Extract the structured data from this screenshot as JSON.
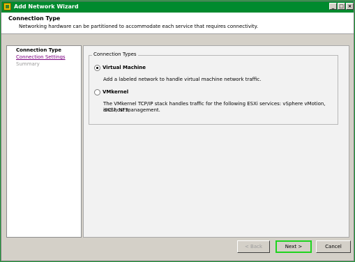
{
  "window": {
    "title": "Add Network Wizard",
    "buttons": {
      "minimize": "_",
      "maximize": "□",
      "close": "×"
    }
  },
  "header": {
    "title": "Connection Type",
    "description": "Networking hardware can be partitioned to accommodate each service that requires connectivity."
  },
  "nav": {
    "items": [
      {
        "label": "Connection Type",
        "state": "current"
      },
      {
        "label": "Connection Settings",
        "state": "link"
      },
      {
        "label": "Summary",
        "state": "disabled"
      }
    ]
  },
  "connection_types": {
    "legend": "Connection Types",
    "options": [
      {
        "label": "Virtual Machine",
        "description": "Add a labeled network to handle virtual machine network traffic.",
        "selected": true
      },
      {
        "label": "VMkernel",
        "description_line1": "The VMkernel TCP/IP stack handles traffic for the following ESXi services: vSphere vMotion, iSCSI, NFS,",
        "description_line2": "and host management.",
        "selected": false
      }
    ]
  },
  "footer": {
    "back_label": "< Back",
    "next_label": "Next >",
    "cancel_label": "Cancel"
  },
  "colors": {
    "titlebar": "#008a2e",
    "desktop_frame": "#1f9a3a",
    "default_button_border": "#1ed41e",
    "visited_link": "#7b0080"
  }
}
